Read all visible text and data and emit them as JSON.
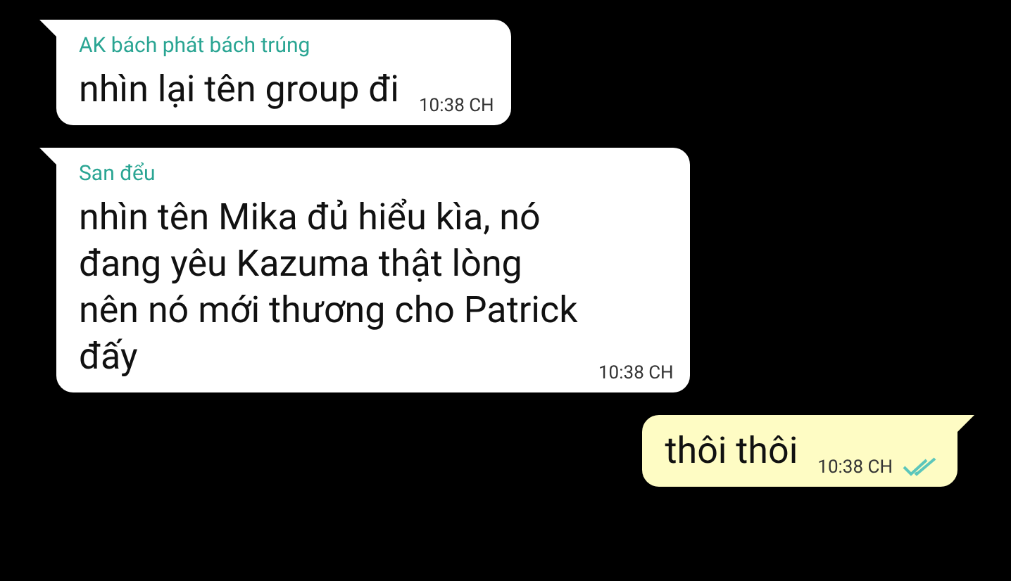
{
  "messages": [
    {
      "kind": "incoming",
      "sender": "AK bách phát bách trúng",
      "text": "nhìn lại tên group đi",
      "time": "10:38 CH"
    },
    {
      "kind": "incoming",
      "sender": "San đểu",
      "text": "nhìn tên Mika đủ hiểu kìa, nó đang yêu Kazuma thật lòng nên nó mới thương cho Patrick đấy",
      "time": "10:38 CH"
    },
    {
      "kind": "outgoing",
      "text": "thôi thôi",
      "time": "10:38 CH",
      "read": true
    }
  ]
}
